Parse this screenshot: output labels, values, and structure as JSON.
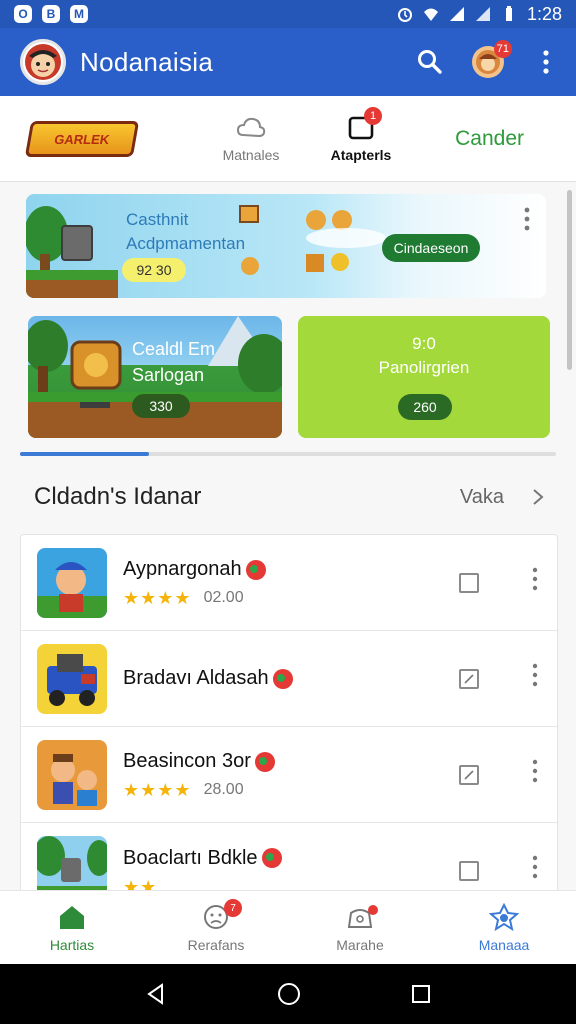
{
  "status_bar": {
    "left_icons": [
      "O",
      "B",
      "M"
    ],
    "time": "1:28"
  },
  "app_bar": {
    "title": "Nodanaisia",
    "notification_count": "71",
    "icons": [
      "app-avatar-icon",
      "search-icon",
      "profile-icon",
      "more-vertical-icon"
    ]
  },
  "tabs": {
    "logo_text": "GARLEK",
    "items": [
      {
        "label": "Matnales",
        "icon": "cloud-icon",
        "active": false
      },
      {
        "label": "Atapterls",
        "icon": "inbox-icon",
        "active": true,
        "badge": "1"
      }
    ],
    "action": "Cander"
  },
  "banner": {
    "title_line1": "Casthnit",
    "title_line2": "Acdpmamentan",
    "pill": "92 30",
    "cta": "Cindaeseon"
  },
  "cards": [
    {
      "title_line1": "Cealdl Em",
      "title_line2": "Sarlogan",
      "value": "330"
    },
    {
      "top": "9:0",
      "title": "Panolirgrien",
      "value": "260"
    }
  ],
  "carousel_progress": 0.24,
  "section": {
    "title": "Cldadn's Idanar",
    "link": "Vaka"
  },
  "list_items": [
    {
      "name": "Aypnargonah",
      "stars": 4,
      "price": "02.00",
      "checked": false
    },
    {
      "name": "Bradavı Aldasah",
      "stars": 0,
      "price": "",
      "checked": true
    },
    {
      "name": "Beasincon 3or",
      "stars": 4,
      "price": "28.00",
      "checked": true
    },
    {
      "name": "Boaclartı Bdkle",
      "stars": 2,
      "price": "",
      "checked": false
    }
  ],
  "bottom_nav": [
    {
      "label": "Hartias",
      "icon": "home-icon"
    },
    {
      "label": "Rerafans",
      "icon": "face-icon",
      "badge": "7"
    },
    {
      "label": "Marahe",
      "icon": "controller-icon"
    },
    {
      "label": "Manaaa",
      "icon": "star-badge-icon"
    }
  ],
  "colors": {
    "status_bar": "#2457b8",
    "app_bar": "#2a5fc9",
    "accent_green": "#2e9a3a",
    "accent_blue": "#3b7bd6",
    "badge_red": "#e53935"
  }
}
